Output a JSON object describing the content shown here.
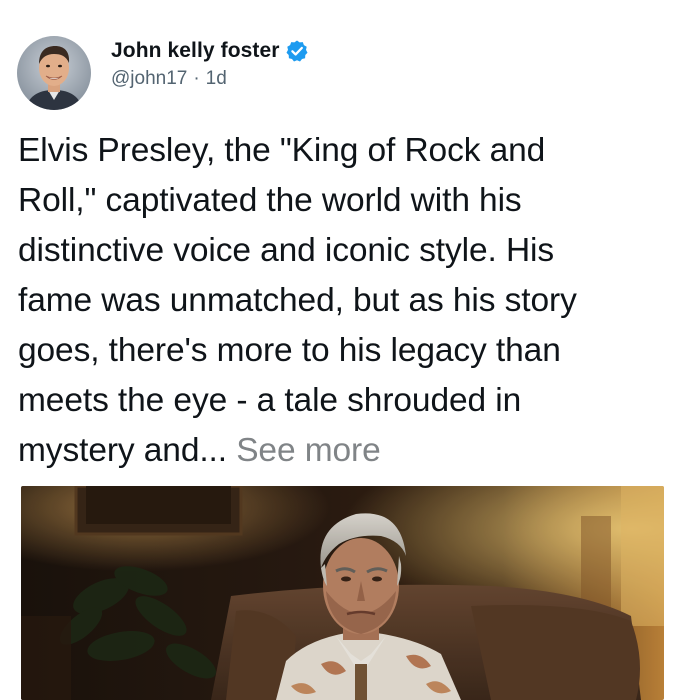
{
  "author": {
    "display_name": "John kelly foster",
    "handle": "@john17",
    "separator": "·",
    "time_ago": "1d",
    "verified": true,
    "avatar_icon": "profile-photo-icon",
    "verified_icon": "verified-badge-icon"
  },
  "post": {
    "text": "Elvis Presley, the \"King of Rock and\nRoll,\" captivated the world with his\ndistinctive voice and iconic style. His\nfame was unmatched, but as his story\ngoes, there's more to his legacy than\nmeets the eye - a tale shrouded in\nmystery and... ",
    "see_more_label": "See more"
  },
  "colors": {
    "text_primary": "#0f1419",
    "text_secondary": "#536471",
    "see_more": "#808487",
    "verified_blue": "#1d9bf0"
  }
}
